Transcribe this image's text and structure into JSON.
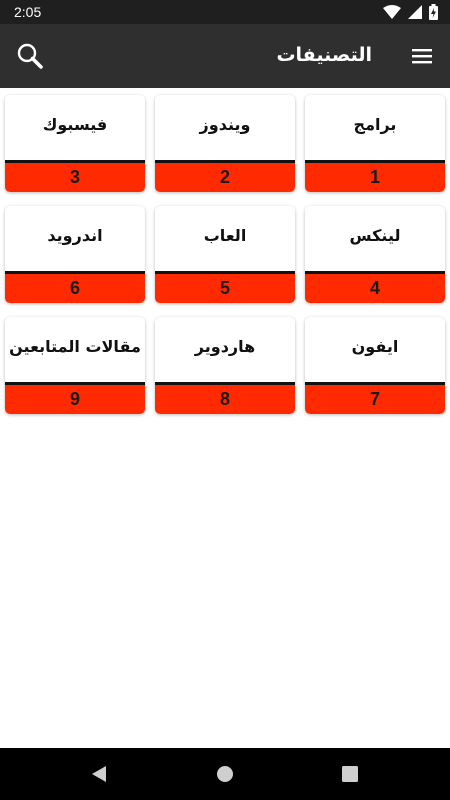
{
  "status_bar": {
    "time": "2:05",
    "icons": [
      "wifi-icon",
      "signal-icon",
      "battery-charging-icon"
    ]
  },
  "app_bar": {
    "title": "التصنيفات",
    "menu_icon": "hamburger-menu-icon",
    "search_icon": "search-icon"
  },
  "categories": [
    {
      "label": "برامج",
      "number": "1"
    },
    {
      "label": "ويندوز",
      "number": "2"
    },
    {
      "label": "فيسبوك",
      "number": "3"
    },
    {
      "label": "لينكس",
      "number": "4"
    },
    {
      "label": "العاب",
      "number": "5"
    },
    {
      "label": "اندرويد",
      "number": "6"
    },
    {
      "label": "ايفون",
      "number": "7"
    },
    {
      "label": "هاردوير",
      "number": "8"
    },
    {
      "label": "مقالات المتابعين",
      "number": "9"
    }
  ],
  "nav_bar": {
    "icons": [
      "back-icon",
      "home-icon",
      "recents-icon"
    ]
  },
  "colors": {
    "status_bar": "#1f1f1f",
    "app_bar": "#2f2f2f",
    "accent": "#ff2a00",
    "separator": "#111111"
  }
}
